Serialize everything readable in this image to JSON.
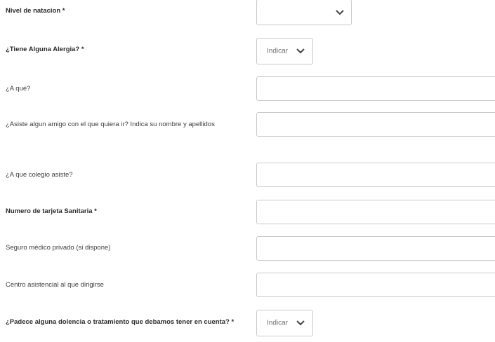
{
  "fields": [
    {
      "label": "Nivel de natacion *",
      "type": "select",
      "value": ""
    },
    {
      "label": "¿Tiene Alguna Alergia? *",
      "type": "select",
      "value": "Indicar"
    },
    {
      "label": "¿A qué?",
      "type": "text",
      "value": ""
    },
    {
      "label": "¿Asiste algun amigo con el que quiera ir? Indica su nombre y apellidos",
      "type": "text",
      "value": ""
    },
    {
      "label": "¿A que colegio asiste?",
      "type": "text",
      "value": ""
    },
    {
      "label": "Numero de tarjeta Sanitaria *",
      "type": "text",
      "value": ""
    },
    {
      "label": "Seguro médico privado (si dispone)",
      "type": "text",
      "value": ""
    },
    {
      "label": "Centro asistencial al que dirigirse",
      "type": "text",
      "value": ""
    },
    {
      "label": "¿Padece alguna dolencia o tratamiento que debamos tener en cuenta? *",
      "type": "select",
      "value": "Indicar"
    }
  ],
  "icons": {
    "select_arrow": "chevron-down-icon"
  },
  "colors": {
    "border": "#c9c9c9",
    "text": "#333333",
    "placeholder": "#6e6e6e"
  }
}
